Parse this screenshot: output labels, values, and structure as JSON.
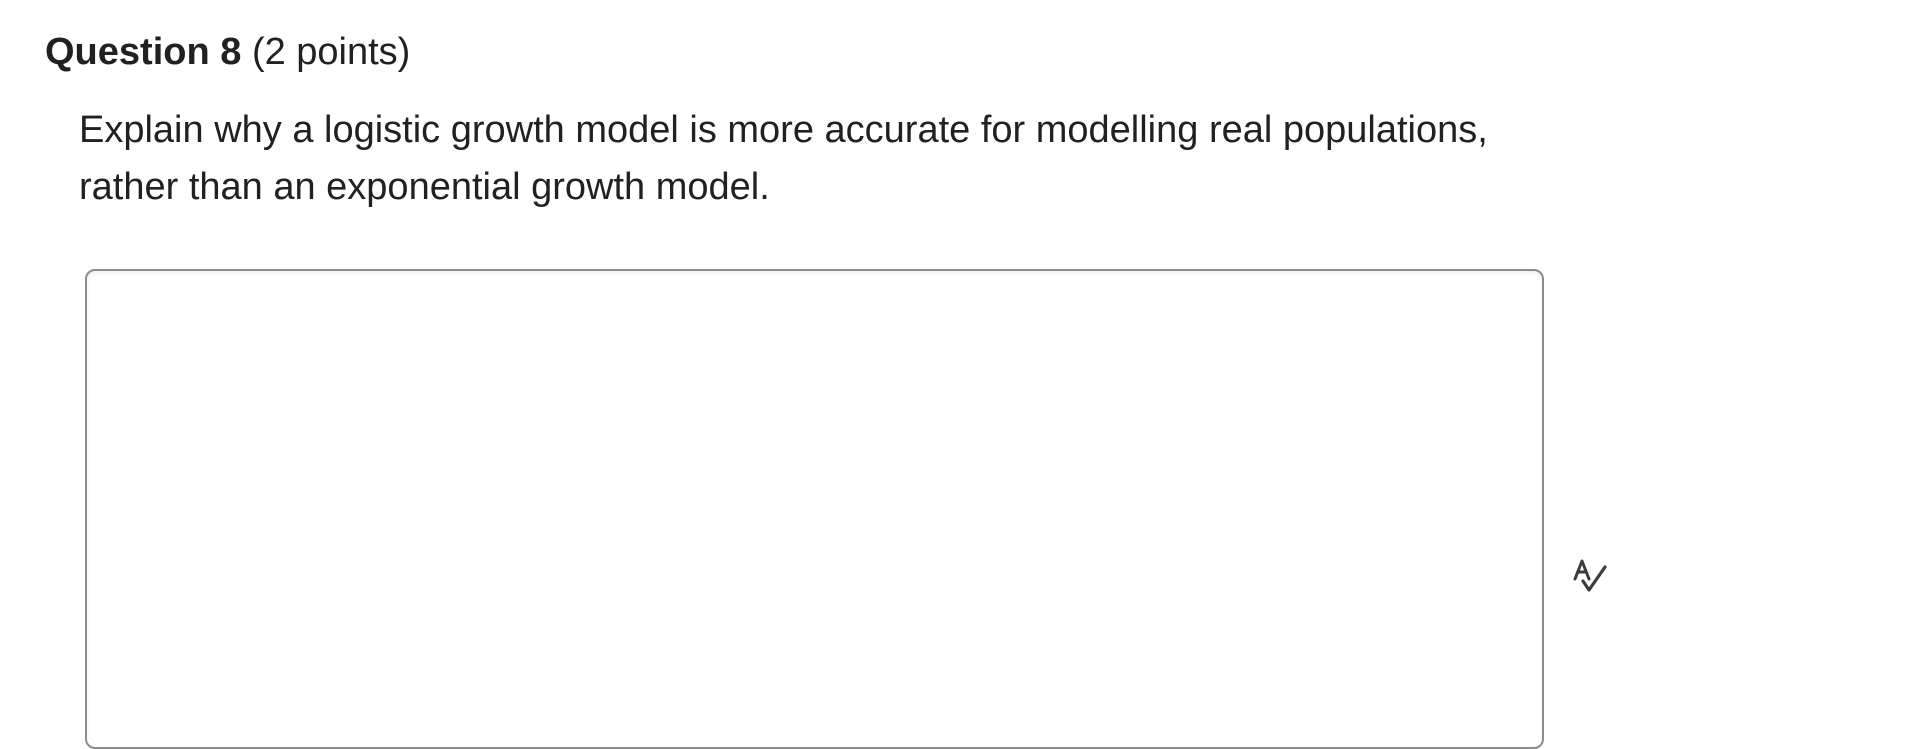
{
  "question": {
    "title": "Question 8",
    "points": "(2 points)",
    "prompt": "Explain why a logistic growth model is more accurate for modelling real populations, rather than an exponential growth model."
  },
  "answer": {
    "value": "",
    "placeholder": ""
  },
  "icons": {
    "spellcheck": "spellcheck-icon"
  },
  "colors": {
    "text": "#202122",
    "border": "#8c8c8c",
    "icon": "#3c3c3c"
  }
}
